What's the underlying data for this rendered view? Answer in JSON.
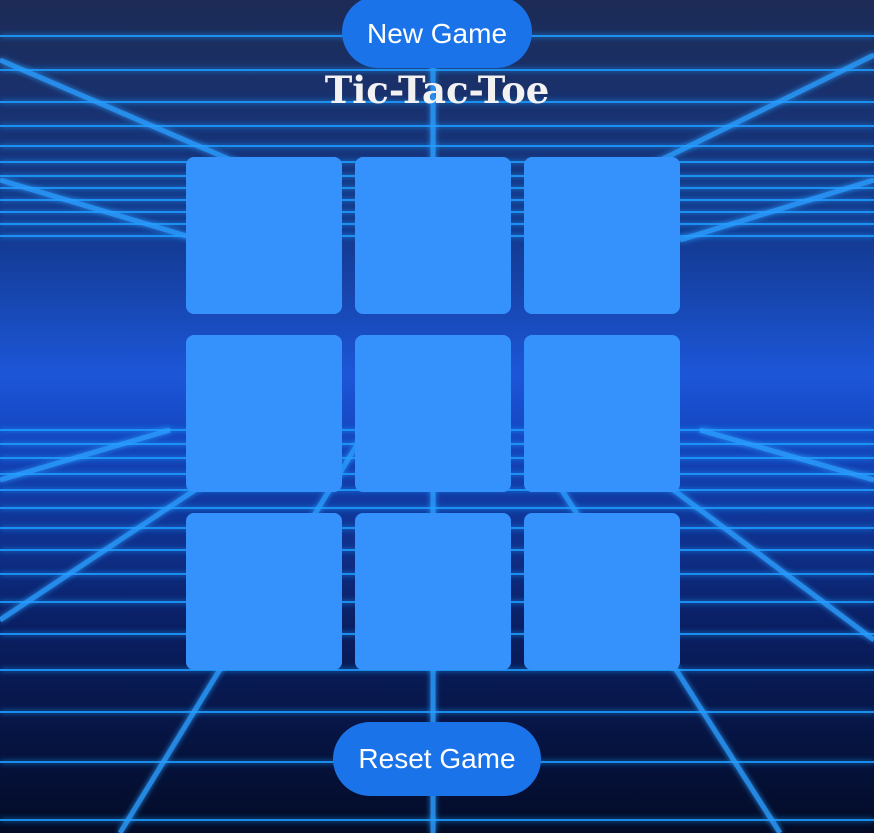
{
  "header": {
    "new_game_label": "New Game",
    "title": "Tic-Tac-Toe"
  },
  "board": {
    "cells": [
      "",
      "",
      "",
      "",
      "",
      "",
      "",
      "",
      ""
    ]
  },
  "footer": {
    "reset_label": "Reset Game"
  },
  "colors": {
    "button": "#1a73e8",
    "cell": "#3592fd",
    "background": "#0b1e5a",
    "grid_glow": "#1e9bff"
  }
}
